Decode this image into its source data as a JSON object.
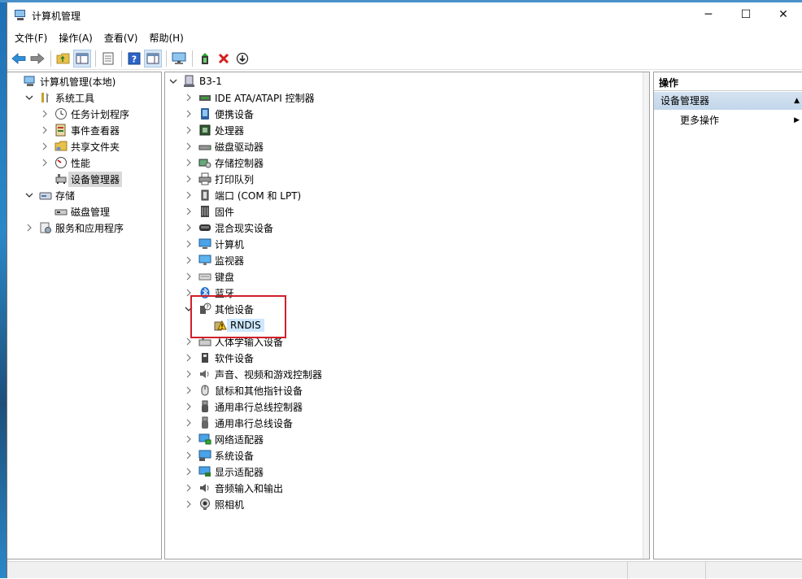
{
  "window": {
    "title": "计算机管理",
    "controls": {
      "minimize": "─",
      "maximize": "☐",
      "close": "✕"
    }
  },
  "menu": [
    "文件(F)",
    "操作(A)",
    "查看(V)",
    "帮助(H)"
  ],
  "left_tree": [
    {
      "label": "计算机管理(本地)",
      "icon": "computer-management-icon",
      "level": 0,
      "expander": ""
    },
    {
      "label": "系统工具",
      "icon": "tools-icon",
      "level": 1,
      "expander": "open"
    },
    {
      "label": "任务计划程序",
      "icon": "clock-icon",
      "level": 2,
      "expander": "closed"
    },
    {
      "label": "事件查看器",
      "icon": "event-viewer-icon",
      "level": 2,
      "expander": "closed"
    },
    {
      "label": "共享文件夹",
      "icon": "shared-folder-icon",
      "level": 2,
      "expander": "closed"
    },
    {
      "label": "性能",
      "icon": "performance-icon",
      "level": 2,
      "expander": "closed"
    },
    {
      "label": "设备管理器",
      "icon": "device-manager-icon",
      "level": 2,
      "expander": "",
      "selected": true
    },
    {
      "label": "存储",
      "icon": "storage-icon",
      "level": 1,
      "expander": "open"
    },
    {
      "label": "磁盘管理",
      "icon": "disk-management-icon",
      "level": 2,
      "expander": ""
    },
    {
      "label": "服务和应用程序",
      "icon": "services-icon",
      "level": 1,
      "expander": "closed"
    }
  ],
  "device_tree": {
    "root": "B3-1",
    "categories": [
      {
        "label": "IDE ATA/ATAPI 控制器",
        "icon": "ide-controller-icon"
      },
      {
        "label": "便携设备",
        "icon": "portable-device-icon"
      },
      {
        "label": "处理器",
        "icon": "processor-icon"
      },
      {
        "label": "磁盘驱动器",
        "icon": "disk-drive-icon"
      },
      {
        "label": "存储控制器",
        "icon": "storage-controller-icon"
      },
      {
        "label": "打印队列",
        "icon": "printer-icon"
      },
      {
        "label": "端口 (COM 和 LPT)",
        "icon": "port-icon"
      },
      {
        "label": "固件",
        "icon": "firmware-icon"
      },
      {
        "label": "混合现实设备",
        "icon": "mixed-reality-icon"
      },
      {
        "label": "计算机",
        "icon": "computer-icon"
      },
      {
        "label": "监视器",
        "icon": "monitor-icon"
      },
      {
        "label": "键盘",
        "icon": "keyboard-icon"
      },
      {
        "label": "蓝牙",
        "icon": "bluetooth-icon"
      },
      {
        "label": "其他设备",
        "icon": "other-devices-icon",
        "expanded": true,
        "children": [
          {
            "label": "RNDIS",
            "icon": "warning-device-icon"
          }
        ]
      },
      {
        "label": "人体学输入设备",
        "icon": "hid-icon"
      },
      {
        "label": "软件设备",
        "icon": "software-device-icon"
      },
      {
        "label": "声音、视频和游戏控制器",
        "icon": "sound-icon"
      },
      {
        "label": "鼠标和其他指针设备",
        "icon": "mouse-icon"
      },
      {
        "label": "通用串行总线控制器",
        "icon": "usb-icon"
      },
      {
        "label": "通用串行总线设备",
        "icon": "usb-device-icon"
      },
      {
        "label": "网络适配器",
        "icon": "network-adapter-icon"
      },
      {
        "label": "系统设备",
        "icon": "system-device-icon"
      },
      {
        "label": "显示适配器",
        "icon": "display-adapter-icon"
      },
      {
        "label": "音频输入和输出",
        "icon": "audio-io-icon"
      },
      {
        "label": "照相机",
        "icon": "camera-icon"
      }
    ]
  },
  "actions": {
    "header": "操作",
    "section": "设备管理器",
    "item": "更多操作"
  },
  "colors": {
    "highlight_box": "#d0202a",
    "selected_bg": "#d9d9d9",
    "actions_section_bg": "#c9dbed"
  }
}
